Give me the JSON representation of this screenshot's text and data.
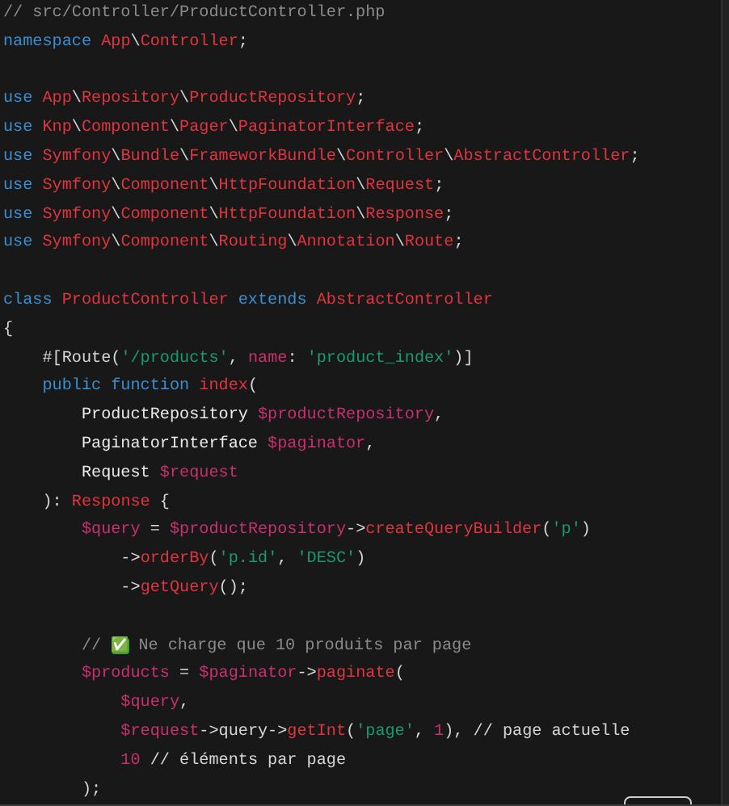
{
  "code_blocks": [
    [
      [
        {
          "kind": "comment",
          "text": "// src/Controller/ProductController.php"
        }
      ],
      [
        {
          "kind": "keyword",
          "text": "namespace "
        },
        {
          "kind": "type",
          "text": "App"
        },
        {
          "kind": "punct",
          "text": "\\"
        },
        {
          "kind": "type",
          "text": "Controller"
        },
        {
          "kind": "punct",
          "text": ";"
        }
      ]
    ],
    [
      [
        {
          "kind": "keyword",
          "text": "use "
        },
        {
          "kind": "type",
          "text": "App"
        },
        {
          "kind": "punct",
          "text": "\\"
        },
        {
          "kind": "type",
          "text": "Repository"
        },
        {
          "kind": "punct",
          "text": "\\"
        },
        {
          "kind": "type",
          "text": "ProductRepository"
        },
        {
          "kind": "punct",
          "text": ";"
        }
      ],
      [
        {
          "kind": "keyword",
          "text": "use "
        },
        {
          "kind": "type",
          "text": "Knp"
        },
        {
          "kind": "punct",
          "text": "\\"
        },
        {
          "kind": "type",
          "text": "Component"
        },
        {
          "kind": "punct",
          "text": "\\"
        },
        {
          "kind": "type",
          "text": "Pager"
        },
        {
          "kind": "punct",
          "text": "\\"
        },
        {
          "kind": "type",
          "text": "PaginatorInterface"
        },
        {
          "kind": "punct",
          "text": ";"
        }
      ],
      [
        {
          "kind": "keyword",
          "text": "use "
        },
        {
          "kind": "type",
          "text": "Symfony"
        },
        {
          "kind": "punct",
          "text": "\\"
        },
        {
          "kind": "type",
          "text": "Bundle"
        },
        {
          "kind": "punct",
          "text": "\\"
        },
        {
          "kind": "type",
          "text": "FrameworkBundle"
        },
        {
          "kind": "punct",
          "text": "\\"
        },
        {
          "kind": "type",
          "text": "Controller"
        },
        {
          "kind": "punct",
          "text": "\\"
        },
        {
          "kind": "type",
          "text": "AbstractController"
        },
        {
          "kind": "punct",
          "text": ";"
        }
      ],
      [
        {
          "kind": "keyword",
          "text": "use "
        },
        {
          "kind": "type",
          "text": "Symfony"
        },
        {
          "kind": "punct",
          "text": "\\"
        },
        {
          "kind": "type",
          "text": "Component"
        },
        {
          "kind": "punct",
          "text": "\\"
        },
        {
          "kind": "type",
          "text": "HttpFoundation"
        },
        {
          "kind": "punct",
          "text": "\\"
        },
        {
          "kind": "type",
          "text": "Request"
        },
        {
          "kind": "punct",
          "text": ";"
        }
      ],
      [
        {
          "kind": "keyword",
          "text": "use "
        },
        {
          "kind": "type",
          "text": "Symfony"
        },
        {
          "kind": "punct",
          "text": "\\"
        },
        {
          "kind": "type",
          "text": "Component"
        },
        {
          "kind": "punct",
          "text": "\\"
        },
        {
          "kind": "type",
          "text": "HttpFoundation"
        },
        {
          "kind": "punct",
          "text": "\\"
        },
        {
          "kind": "type",
          "text": "Response"
        },
        {
          "kind": "punct",
          "text": ";"
        }
      ],
      [
        {
          "kind": "keyword",
          "text": "use "
        },
        {
          "kind": "type",
          "text": "Symfony"
        },
        {
          "kind": "punct",
          "text": "\\"
        },
        {
          "kind": "type",
          "text": "Component"
        },
        {
          "kind": "punct",
          "text": "\\"
        },
        {
          "kind": "type",
          "text": "Routing"
        },
        {
          "kind": "punct",
          "text": "\\"
        },
        {
          "kind": "type",
          "text": "Annotation"
        },
        {
          "kind": "punct",
          "text": "\\"
        },
        {
          "kind": "type",
          "text": "Route"
        },
        {
          "kind": "punct",
          "text": ";"
        }
      ]
    ],
    [
      [
        {
          "kind": "keyword",
          "text": "class "
        },
        {
          "kind": "type",
          "text": "ProductController "
        },
        {
          "kind": "keyword",
          "text": "extends "
        },
        {
          "kind": "type",
          "text": "AbstractController"
        }
      ],
      [
        {
          "kind": "punct",
          "text": "{"
        }
      ],
      [
        {
          "kind": "punct",
          "text": "    #[Route("
        },
        {
          "kind": "string",
          "text": "'/products'"
        },
        {
          "kind": "punct",
          "text": ", "
        },
        {
          "kind": "variable",
          "text": "name"
        },
        {
          "kind": "punct",
          "text": ": "
        },
        {
          "kind": "string",
          "text": "'product_index'"
        },
        {
          "kind": "punct",
          "text": ")]"
        }
      ],
      [
        {
          "kind": "keyword",
          "text": "    public function "
        },
        {
          "kind": "function",
          "text": "index"
        },
        {
          "kind": "punct",
          "text": "("
        }
      ],
      [
        {
          "kind": "plain",
          "text": "        ProductRepository "
        },
        {
          "kind": "variable",
          "text": "$productRepository"
        },
        {
          "kind": "punct",
          "text": ","
        }
      ],
      [
        {
          "kind": "plain",
          "text": "        PaginatorInterface "
        },
        {
          "kind": "variable",
          "text": "$paginator"
        },
        {
          "kind": "punct",
          "text": ","
        }
      ],
      [
        {
          "kind": "plain",
          "text": "        Request "
        },
        {
          "kind": "variable",
          "text": "$request"
        }
      ],
      [
        {
          "kind": "punct",
          "text": "    ): "
        },
        {
          "kind": "type",
          "text": "Response"
        },
        {
          "kind": "punct",
          "text": " {"
        }
      ],
      [
        {
          "kind": "variable",
          "text": "        $query"
        },
        {
          "kind": "punct",
          "text": " = "
        },
        {
          "kind": "variable",
          "text": "$productRepository"
        },
        {
          "kind": "punct",
          "text": "->"
        },
        {
          "kind": "function",
          "text": "createQueryBuilder"
        },
        {
          "kind": "punct",
          "text": "("
        },
        {
          "kind": "string",
          "text": "'p'"
        },
        {
          "kind": "punct",
          "text": ")"
        }
      ],
      [
        {
          "kind": "punct",
          "text": "            ->"
        },
        {
          "kind": "function",
          "text": "orderBy"
        },
        {
          "kind": "punct",
          "text": "("
        },
        {
          "kind": "string",
          "text": "'p.id'"
        },
        {
          "kind": "punct",
          "text": ", "
        },
        {
          "kind": "string",
          "text": "'DESC'"
        },
        {
          "kind": "punct",
          "text": ")"
        }
      ],
      [
        {
          "kind": "punct",
          "text": "            ->"
        },
        {
          "kind": "function",
          "text": "getQuery"
        },
        {
          "kind": "punct",
          "text": "();"
        }
      ]
    ],
    [
      [
        {
          "kind": "comment",
          "text": "        // "
        },
        {
          "kind": "emoji",
          "text": "✅"
        },
        {
          "kind": "comment",
          "text": " Ne charge que 10 produits par page"
        }
      ],
      [
        {
          "kind": "variable",
          "text": "        $products"
        },
        {
          "kind": "punct",
          "text": " = "
        },
        {
          "kind": "variable",
          "text": "$paginator"
        },
        {
          "kind": "punct",
          "text": "->"
        },
        {
          "kind": "function",
          "text": "paginate"
        },
        {
          "kind": "punct",
          "text": "("
        }
      ],
      [
        {
          "kind": "variable",
          "text": "            $query"
        },
        {
          "kind": "punct",
          "text": ","
        }
      ],
      [
        {
          "kind": "variable",
          "text": "            $request"
        },
        {
          "kind": "punct",
          "text": "->query->"
        },
        {
          "kind": "function",
          "text": "getInt"
        },
        {
          "kind": "punct",
          "text": "("
        },
        {
          "kind": "string",
          "text": "'page'"
        },
        {
          "kind": "punct",
          "text": ", "
        },
        {
          "kind": "number",
          "text": "1"
        },
        {
          "kind": "punct",
          "text": "), // page actuelle"
        }
      ],
      [
        {
          "kind": "number",
          "text": "            10"
        },
        {
          "kind": "punct",
          "text": " // éléments par page"
        }
      ],
      [
        {
          "kind": "punct",
          "text": "        );"
        }
      ]
    ]
  ]
}
